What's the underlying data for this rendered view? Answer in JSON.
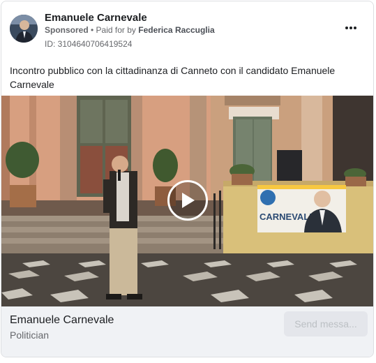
{
  "post": {
    "page_name": "Emanuele Carnevale",
    "sponsored_label": "Sponsored",
    "separator": " • ",
    "paid_for_prefix": "Paid for by ",
    "paid_for_name": "Federica Raccuglia",
    "id_text": "ID: 3104640706419524",
    "body_text": "Incontro pubblico con la cittadinanza di Canneto con il candidato Emanuele Carnevale",
    "more_icon": "more-horizontal-icon"
  },
  "media": {
    "type": "video",
    "play_icon": "play-icon",
    "banner_text": "CARNEVALE"
  },
  "footer": {
    "title": "Emanuele Carnevale",
    "subtitle": "Politician",
    "cta_label": "Send messa..."
  }
}
